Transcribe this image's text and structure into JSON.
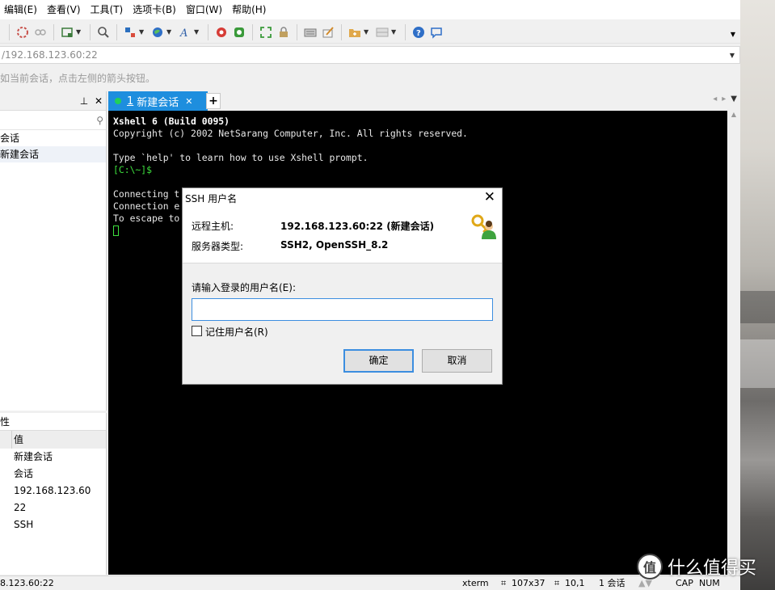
{
  "menu": [
    "编辑(E)",
    "查看(V)",
    "工具(T)",
    "选项卡(B)",
    "窗口(W)",
    "帮助(H)"
  ],
  "address": {
    "value": "/192.168.123.60:22"
  },
  "hint": "如当前会话，点击左侧的箭头按钮。",
  "session_panel": {
    "pin": "ᵖ",
    "close": "✕",
    "items": [
      "会话",
      "新建会话"
    ]
  },
  "properties": {
    "title": "性",
    "header_value": "值",
    "rows": [
      "新建会话",
      "会话",
      "192.168.123.60",
      "22",
      "SSH"
    ]
  },
  "tab": {
    "number": "1",
    "label": "新建会话",
    "add": "+"
  },
  "terminal": {
    "header": "Xshell 6 (Build 0095)",
    "copyright": "Copyright (c) 2002 NetSarang Computer, Inc. All rights reserved.",
    "help": "Type `help' to learn how to use Xshell prompt.",
    "prompt": "[C:\\~]$",
    "line1": "Connecting t",
    "line2": "Connection e",
    "line3": "To escape to"
  },
  "dialog": {
    "title": "SSH 用户名",
    "remote_host_label": "远程主机:",
    "remote_host_value": "192.168.123.60:22 (新建会话)",
    "server_type_label": "服务器类型:",
    "server_type_value": "SSH2, OpenSSH_8.2",
    "prompt": "请输入登录的用户名(E):",
    "username_value": "",
    "remember_label": "记住用户名(R)",
    "ok": "确定",
    "cancel": "取消"
  },
  "status": {
    "address": "8.123.60:22",
    "term": "xterm",
    "size": "107x37",
    "pos": "10,1",
    "sessions": "1 会话",
    "cap": "CAP",
    "num": "NUM"
  },
  "watermark": {
    "logo": "值",
    "text": "什么值得买"
  }
}
